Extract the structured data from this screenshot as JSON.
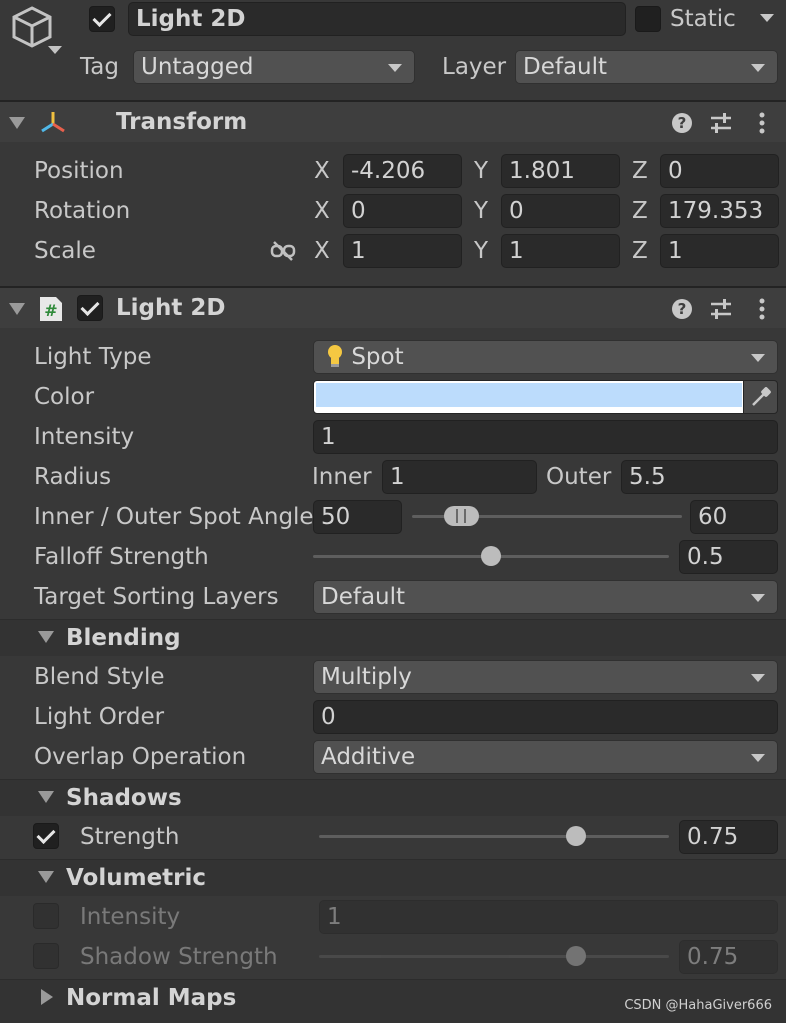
{
  "object": {
    "name": "Light 2D",
    "active": true,
    "static_label": "Static",
    "static_checked": false,
    "tag_label": "Tag",
    "tag_value": "Untagged",
    "layer_label": "Layer",
    "layer_value": "Default"
  },
  "transform": {
    "title": "Transform",
    "position": {
      "label": "Position",
      "x": "-4.206",
      "y": "1.801",
      "z": "0"
    },
    "rotation": {
      "label": "Rotation",
      "x": "0",
      "y": "0",
      "z": "179.353"
    },
    "scale": {
      "label": "Scale",
      "x": "1",
      "y": "1",
      "z": "1"
    },
    "axis": {
      "x": "X",
      "y": "Y",
      "z": "Z"
    }
  },
  "light": {
    "title": "Light 2D",
    "enabled": true,
    "light_type": {
      "label": "Light Type",
      "value": "Spot"
    },
    "color": {
      "label": "Color",
      "hex": "#bcdcfc"
    },
    "intensity": {
      "label": "Intensity",
      "value": "1"
    },
    "radius": {
      "label": "Radius",
      "inner_label": "Inner",
      "inner": "1",
      "outer_label": "Outer",
      "outer": "5.5"
    },
    "spot_angle": {
      "label": "Inner / Outer Spot Angle",
      "inner": "50",
      "outer": "60"
    },
    "falloff": {
      "label": "Falloff Strength",
      "value": "0.5",
      "fraction": 0.5
    },
    "sorting_layers": {
      "label": "Target Sorting Layers",
      "value": "Default"
    }
  },
  "blending": {
    "title": "Blending",
    "blend_style": {
      "label": "Blend Style",
      "value": "Multiply"
    },
    "light_order": {
      "label": "Light Order",
      "value": "0"
    },
    "overlap": {
      "label": "Overlap Operation",
      "value": "Additive"
    }
  },
  "shadows": {
    "title": "Shadows",
    "strength": {
      "label": "Strength",
      "value": "0.75",
      "fraction": 0.75,
      "checked": true
    }
  },
  "volumetric": {
    "title": "Volumetric",
    "intensity": {
      "label": "Intensity",
      "value": "1",
      "checked": false
    },
    "shadow_strength": {
      "label": "Shadow Strength",
      "value": "0.75",
      "fraction": 0.75,
      "checked": false
    }
  },
  "normal_maps": {
    "title": "Normal Maps"
  },
  "watermark": "CSDN @HahaGiver666",
  "icons": [
    "cube-icon",
    "transform-axes-icon",
    "help-icon",
    "presets-icon",
    "more-icon",
    "script-icon",
    "unlink-icon",
    "bulb-icon",
    "eyedropper-icon"
  ],
  "colors": {
    "background": "#383838",
    "header": "#3e3e3e",
    "field": "#2a2a2a",
    "dropdown": "#515151"
  }
}
